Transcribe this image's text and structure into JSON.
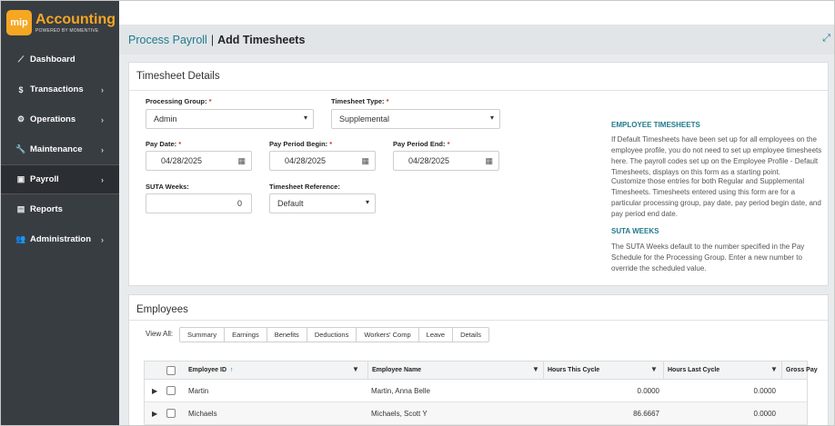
{
  "app": {
    "logo_mark": "mip",
    "name": "Accounting",
    "tagline": "POWERED BY MOMENTIVE"
  },
  "sidebar": {
    "items": [
      {
        "label": "Dashboard",
        "icon": "chart-line-icon",
        "glyph": "⟋",
        "chevron": ""
      },
      {
        "label": "Transactions",
        "icon": "dollar-icon",
        "glyph": "$",
        "chevron": "›"
      },
      {
        "label": "Operations",
        "icon": "gears-icon",
        "glyph": "⚙",
        "chevron": "›"
      },
      {
        "label": "Maintenance",
        "icon": "wrench-icon",
        "glyph": "🔧",
        "chevron": "›"
      },
      {
        "label": "Payroll",
        "icon": "money-icon",
        "glyph": "▣",
        "chevron": "›"
      },
      {
        "label": "Reports",
        "icon": "document-icon",
        "glyph": "▤",
        "chevron": ""
      },
      {
        "label": "Administration",
        "icon": "users-icon",
        "glyph": "👥",
        "chevron": "›"
      }
    ]
  },
  "header": {
    "crumb": "Process Payroll",
    "sep": "|",
    "current": "Add Timesheets"
  },
  "details": {
    "title": "Timesheet Details",
    "processing_group": {
      "label": "Processing Group:",
      "value": "Admin"
    },
    "timesheet_type": {
      "label": "Timesheet Type:",
      "value": "Supplemental"
    },
    "pay_date": {
      "label": "Pay Date:",
      "value": "04/28/2025"
    },
    "pay_period_begin": {
      "label": "Pay Period Begin:",
      "value": "04/28/2025"
    },
    "pay_period_end": {
      "label": "Pay Period End:",
      "value": "04/28/2025"
    },
    "suta_weeks": {
      "label": "SUTA Weeks:",
      "value": "0"
    },
    "timesheet_reference": {
      "label": "Timesheet Reference:",
      "value": "Default"
    },
    "required_mark": "*",
    "info": {
      "h1": "EMPLOYEE TIMESHEETS",
      "p1": "If Default Timesheets have been set up for all employees on the employee profile, you do not need to set up employee timesheets here. The payroll codes set up on the Employee Profile - Default Timesheets, displays on this form as a starting point.",
      "p2": "Customize those entries for both Regular and Supplemental Timesheets. Timesheets entered using this form are for a particular processing group, pay date, pay period begin date, and pay period end date.",
      "h2": "SUTA WEEKS",
      "p3": "The SUTA Weeks default to the number specified in the Pay Schedule for the Processing Group. Enter a new number to override the scheduled value."
    }
  },
  "employees": {
    "title": "Employees",
    "view_all": "View All:",
    "tabs": [
      "Summary",
      "Earnings",
      "Benefits",
      "Deductions",
      "Workers' Comp",
      "Leave",
      "Details"
    ],
    "columns": {
      "id": "Employee ID",
      "sort": "↑",
      "name": "Employee Name",
      "hours_this": "Hours This Cycle",
      "hours_last": "Hours Last Cycle",
      "gross": "Gross Pay"
    },
    "rows": [
      {
        "id": "Martin",
        "name": "Martin, Anna Belle",
        "hours_this": "0.0000",
        "hours_last": "0.0000"
      },
      {
        "id": "Michaels",
        "name": "Michaels, Scott Y",
        "hours_this": "86.6667",
        "hours_last": "0.0000"
      }
    ]
  },
  "colors": {
    "accent": "#1f7a8c",
    "brand": "#f5a623",
    "sidebar": "#383d42",
    "required": "#c0392b"
  }
}
